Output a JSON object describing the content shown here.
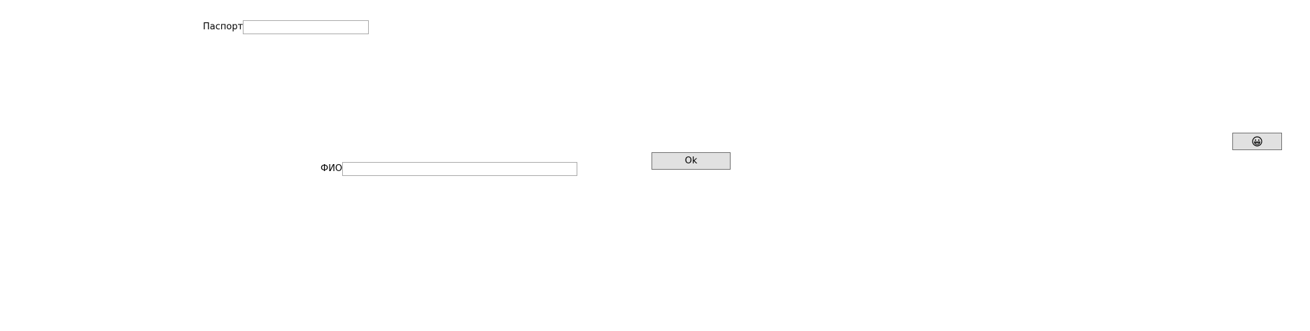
{
  "form": {
    "passport": {
      "label": "Паспорт",
      "value": "",
      "placeholder": ""
    },
    "fio": {
      "label": "ФИО",
      "value": "",
      "placeholder": ""
    },
    "ok_button": {
      "label": "Ok"
    },
    "emoji_button": {
      "icon": "grinning-face-icon"
    }
  },
  "colors": {
    "button_face": "#e1e1e1",
    "button_border": "#707070",
    "input_border": "#a9a9a9",
    "background": "#ffffff"
  }
}
